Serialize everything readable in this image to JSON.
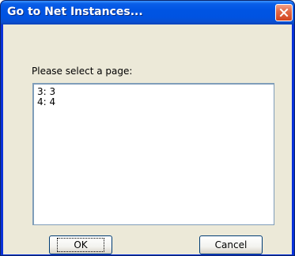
{
  "window": {
    "title": "Go to Net Instances...",
    "close_icon": "close-icon"
  },
  "dialog": {
    "prompt": "Please select a page:",
    "list_items": [
      "3: 3",
      "4: 4"
    ]
  },
  "buttons": {
    "ok_label": "OK",
    "cancel_label": "Cancel"
  },
  "colors": {
    "titlebar": "#0054e3",
    "client_background": "#ece9d8",
    "close_button": "#d2441f"
  }
}
